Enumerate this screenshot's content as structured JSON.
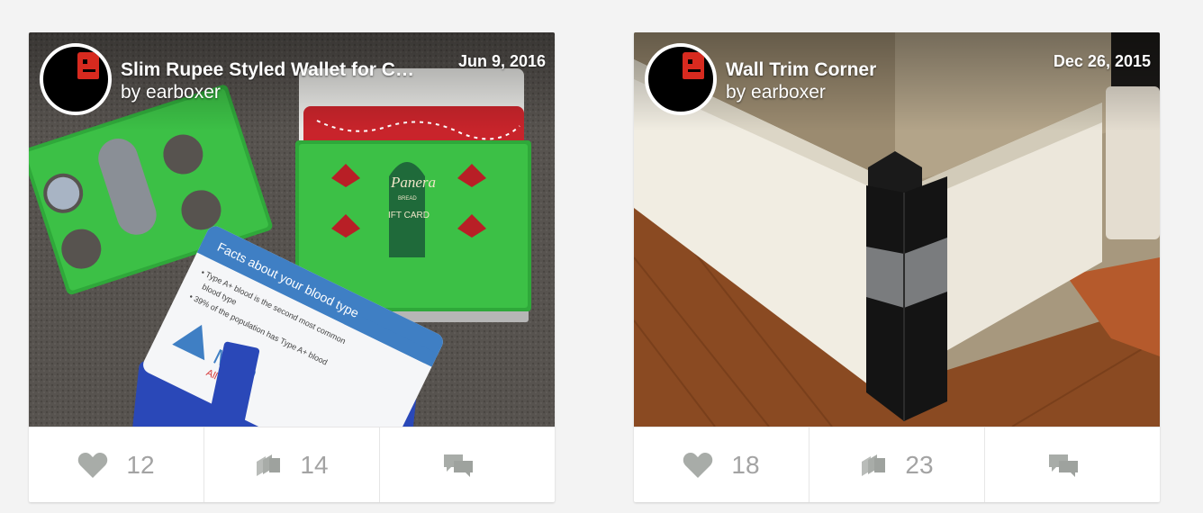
{
  "cards": [
    {
      "title": "Slim Rupee Styled Wallet for Cards",
      "creator": "by earboxer",
      "date": "Jun 9, 2016",
      "card_text": {
        "heading": "Facts about your blood type",
        "line1": "• Type A+ blood is the second most common",
        "line2": "blood type",
        "line3": "• 39% of the population has Type A+ blood",
        "brand": "Mich",
        "tagline": "All blood",
        "gift": "Panera",
        "gift_sub": "BREAD",
        "gift_card": "IFT CARD"
      },
      "likes": "12",
      "collections": "14",
      "comments": ""
    },
    {
      "title": "Wall Trim Corner",
      "creator": "by earboxer",
      "date": "Dec 26, 2015",
      "likes": "18",
      "collections": "23",
      "comments": ""
    }
  ],
  "icons": {
    "like": "heart-icon",
    "collect": "collection-stack-icon",
    "comment": "chat-bubbles-icon"
  },
  "colors": {
    "icon_gray": "#a8aca8",
    "avatar_red": "#d72a1f"
  }
}
